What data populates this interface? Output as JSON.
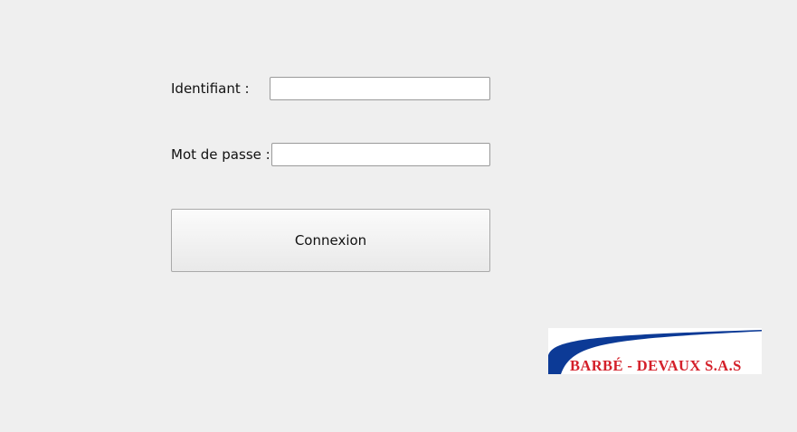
{
  "login_form": {
    "username_label": "Identifiant :",
    "username_value": "",
    "password_label": "Mot de passe :",
    "password_value": "",
    "submit_label": "Connexion"
  },
  "logo": {
    "company_name": "BARBÉ - DEVAUX S.A.S",
    "swoosh_color": "#0c3a96",
    "text_color": "#d4202a"
  }
}
